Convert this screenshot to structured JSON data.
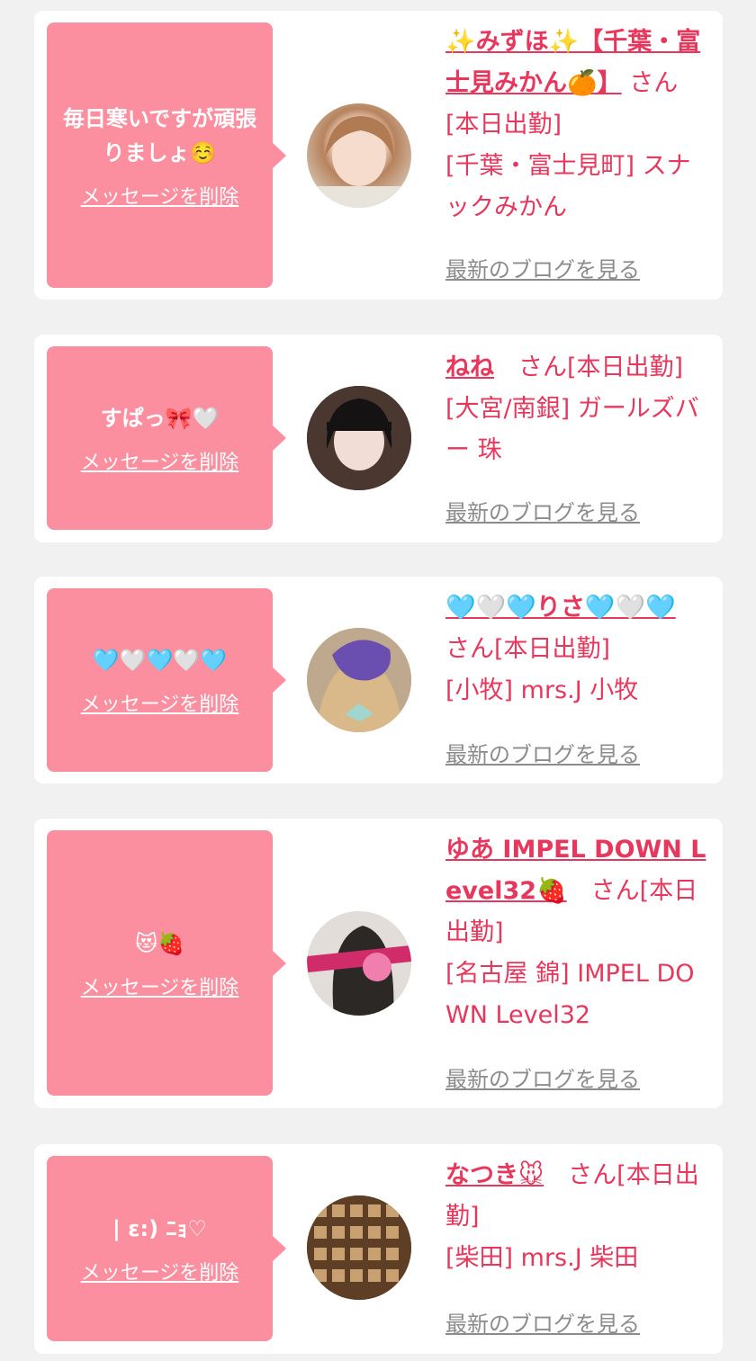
{
  "cards": [
    {
      "message": "毎日寒いですが頑張りましょ☺️",
      "delete_label": "メッセージを削除",
      "name": "✨みずほ✨【千葉・富士見みかん🍊】",
      "status": " さん[本日出勤]",
      "shop": "[千葉・富士見町] スナックみかん",
      "blog_label": "最新のブログを見る"
    },
    {
      "message": "すぱっ🎀🤍",
      "delete_label": "メッセージを削除",
      "name": "ねね",
      "status": "　さん[本日出勤]",
      "shop": "[大宮/南銀] ガールズバー 珠",
      "blog_label": "最新のブログを見る"
    },
    {
      "message": "🩵🤍🩵🤍🩵",
      "delete_label": "メッセージを削除",
      "name": "🩵🤍🩵りさ🩵🤍🩵",
      "status": "　さん[本日出勤]",
      "shop": "[小牧] mrs.J 小牧",
      "blog_label": "最新のブログを見る"
    },
    {
      "message": "😻🍓",
      "delete_label": "メッセージを削除",
      "name": "ゆあ IMPEL DOWN Level32🍓",
      "status": "　さん[本日出勤]",
      "shop": "[名古屋 錦] IMPEL DOWN Level32",
      "blog_label": "最新のブログを見る"
    },
    {
      "message": "| ε:) ﾆｮ♡",
      "delete_label": "メッセージを削除",
      "name": "なつき🐭",
      "status": "　さん[本日出勤]",
      "shop": "[柴田] mrs.J 柴田",
      "blog_label": "最新のブログを見る"
    }
  ]
}
